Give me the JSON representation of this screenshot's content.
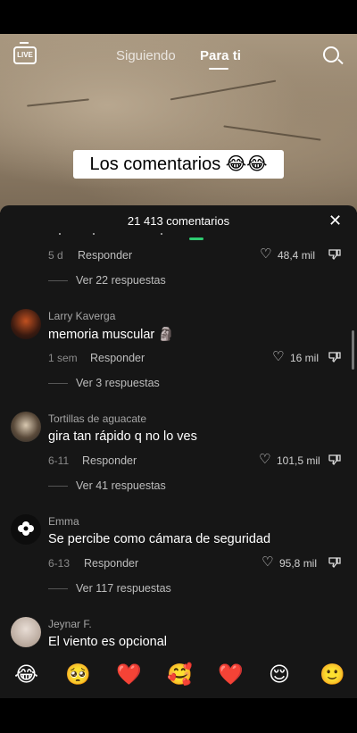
{
  "header": {
    "live_label": "LIVE",
    "tab_following": "Siguiendo",
    "tab_for_you": "Para ti"
  },
  "video": {
    "caption": "Los comentarios 😂😂"
  },
  "comments_sheet": {
    "title": "21 413 comentarios",
    "close_symbol": "✕",
    "comments": [
      {
        "author": "",
        "text": "",
        "date": "5 d",
        "reply_label": "Responder",
        "likes": "48,4 mil",
        "view_replies": "Ver 22 respuestas"
      },
      {
        "author": "Larry Kaverga",
        "text": "memoria muscular 🗿",
        "date": "1 sem",
        "reply_label": "Responder",
        "likes": "16 mil",
        "view_replies": "Ver 3 respuestas"
      },
      {
        "author": "Tortillas de aguacate",
        "text": "gira tan rápido q no lo ves",
        "date": "6-11",
        "reply_label": "Responder",
        "likes": "101,5 mil",
        "view_replies": "Ver 41 respuestas"
      },
      {
        "author": "Emma",
        "text": "Se percibe como cámara de seguridad",
        "date": "6-13",
        "reply_label": "Responder",
        "likes": "95,8 mil",
        "view_replies": "Ver 117 respuestas"
      },
      {
        "author": "Jeynar F.",
        "text": "El viento es opcional"
      }
    ]
  },
  "emoji_bar": [
    "😂",
    "🥺",
    "❤️",
    "🥰",
    "❤️",
    "😌",
    "🙂"
  ]
}
